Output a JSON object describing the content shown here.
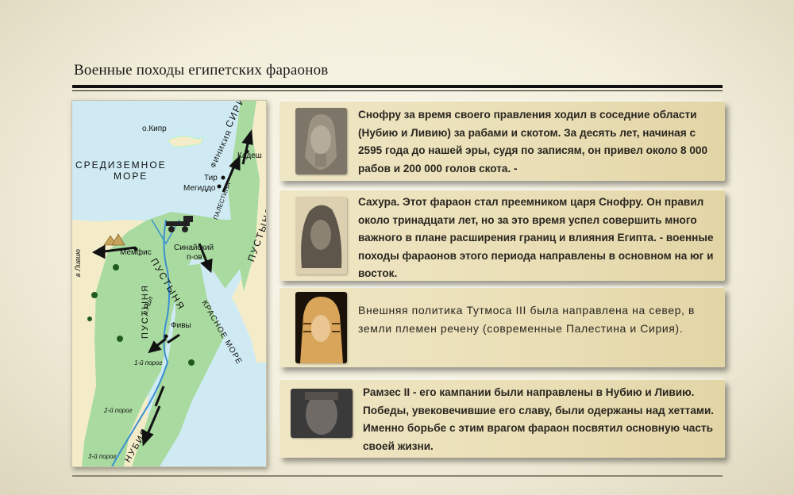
{
  "title": "Военные походы египетских фараонов",
  "map": {
    "labels": {
      "cyprus": "о.Кипр",
      "sea1": "СРЕДИЗЕМНОЕ",
      "sea2": "МОРЕ",
      "kadesh": "Кадеш",
      "syria": "СИРИЯ",
      "phoenicia": "ФИНИКИЯ",
      "tyre": "Тир",
      "megiddo": "Мегиддо",
      "palestine": "ПАЛЕСТИНА",
      "desert_east": "ПУСТЫНЯ",
      "sinai1": "Синайский",
      "sinai2": "п-ов",
      "memphis": "Мемфис",
      "to_libya": "в Ливию",
      "desert_center": "ПУСТЫНЯ",
      "nile": "р.Нил",
      "red_sea": "КРАСНОЕ МОРЕ",
      "thebes": "Фивы",
      "desert_west": "ПУСТЫНЯ",
      "cataract1": "1-й порог",
      "cataract2": "2-й порог",
      "cataract3": "3-й порог",
      "nubia": "НУБИЯ"
    }
  },
  "pharaohs": [
    {
      "portrait": "snofru-portrait",
      "text": "Снофру за время своего правления ходил в соседние области (Нубию и Ливию) за рабами и скотом. За десять лет, начиная с 2595 года до нашей эры, судя по записям, он привел около 8 000 рабов и 200 000 голов скота. -"
    },
    {
      "portrait": "sahure-portrait",
      "text": "Сахура. Этот фараон стал преемником царя Снофру. Он правил около тринадцати лет, но за это время успел совершить много важного в плане расширения границ и влияния Египта. - военные походы фараонов этого периода направлены в основном на юг и восток."
    },
    {
      "portrait": "thutmose-portrait",
      "text": "Внешняя политика Тутмоса III была направлена на север, в земли племен речену (современные Палестина и Сирия)."
    },
    {
      "portrait": "ramses-portrait",
      "text": "Рамзес II - его кампании были направлены в Нубию и Ливию. Победы, увековечившие его славу, были одержаны над хеттами. Именно борьбе с этим врагом фараон посвятил основную часть своей жизни."
    }
  ],
  "colors": {
    "land": "#a9dba0",
    "water": "#cfeaf3",
    "desert": "#f4ecc9",
    "card": "#ebe1b8"
  }
}
